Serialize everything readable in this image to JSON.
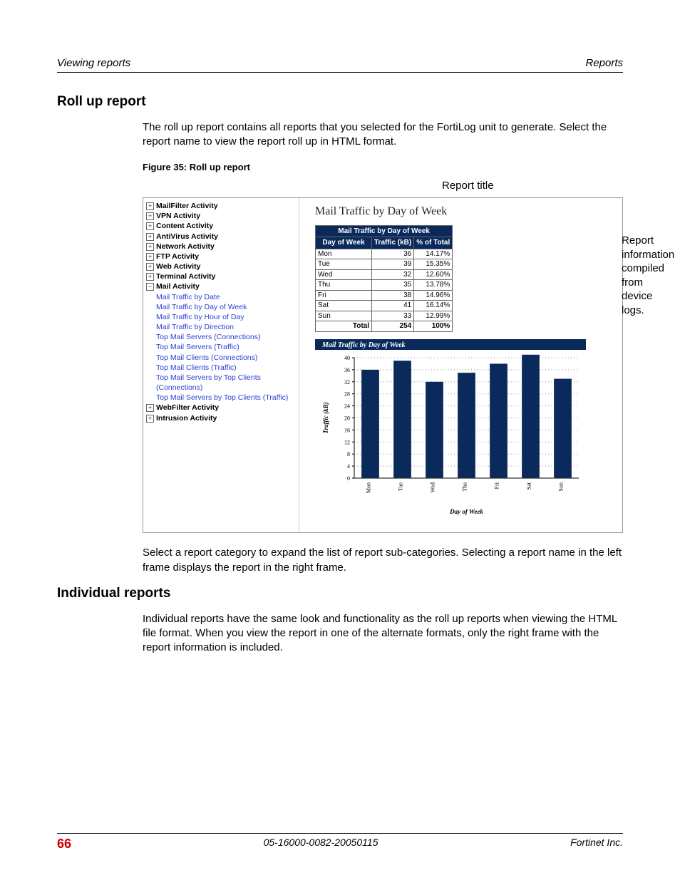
{
  "header": {
    "left": "Viewing reports",
    "right": "Reports"
  },
  "section1": {
    "title": "Roll up report",
    "para1": "The roll up report contains all reports that you selected for the FortiLog unit to generate. Select the report name to view the report roll up in HTML format.",
    "figcap": "Figure 35: Roll up report",
    "callout_rt": "Report title",
    "anno_info": "Report information compiled from device logs.",
    "para2": "Select a report category to expand the list of report sub-categories. Selecting a report name in the left frame displays the report in the right frame."
  },
  "nav": {
    "expandable": [
      "MailFilter Activity",
      "VPN Activity",
      "Content Activity",
      "AntiVirus Activity",
      "Network Activity",
      "FTP Activity",
      "Web Activity",
      "Terminal Activity"
    ],
    "open_label": "Mail Activity",
    "links": [
      "Mail Traffic by Date",
      "Mail Traffic by Day of Week",
      "Mail Traffic by Hour of Day",
      "Mail Traffic by Direction",
      "Top Mail Servers (Connections)",
      "Top Mail Servers (Traffic)",
      "Top Mail Clients (Connections)",
      "Top Mail Clients (Traffic)",
      "Top Mail Servers by Top Clients (Connections)",
      "Top Mail Servers by Top Clients (Traffic)"
    ],
    "tail": [
      "WebFilter Activity",
      "Intrusion Activity"
    ]
  },
  "report": {
    "title": "Mail Traffic by Day of Week",
    "tbl_header": "Mail Traffic by Day of Week",
    "col1": "Day of Week",
    "col2": "Traffic (kB)",
    "col3": "% of Total",
    "total_label": "Total",
    "total_kb": "254",
    "total_pct": "100%"
  },
  "chart_data": {
    "type": "bar",
    "title": "Mail Traffic by Day of Week",
    "xlabel": "Day of Week",
    "ylabel": "Traffic (kB)",
    "ylim": [
      0,
      40
    ],
    "categories": [
      "Mon",
      "Tue",
      "Wed",
      "Thu",
      "Fri",
      "Sat",
      "Sun"
    ],
    "values": [
      36,
      39,
      32,
      35,
      38,
      41,
      33
    ],
    "percent": [
      "14.17%",
      "15.35%",
      "12.60%",
      "13.78%",
      "14.96%",
      "16.14%",
      "12.99%"
    ]
  },
  "section2": {
    "title": "Individual reports",
    "para": "Individual reports have the same look and functionality as the roll up reports when viewing the HTML file format. When you view the report in one of the alternate formats, only the right frame with the report information is included."
  },
  "footer": {
    "page": "66",
    "docid": "05-16000-0082-20050115",
    "company": "Fortinet Inc."
  }
}
